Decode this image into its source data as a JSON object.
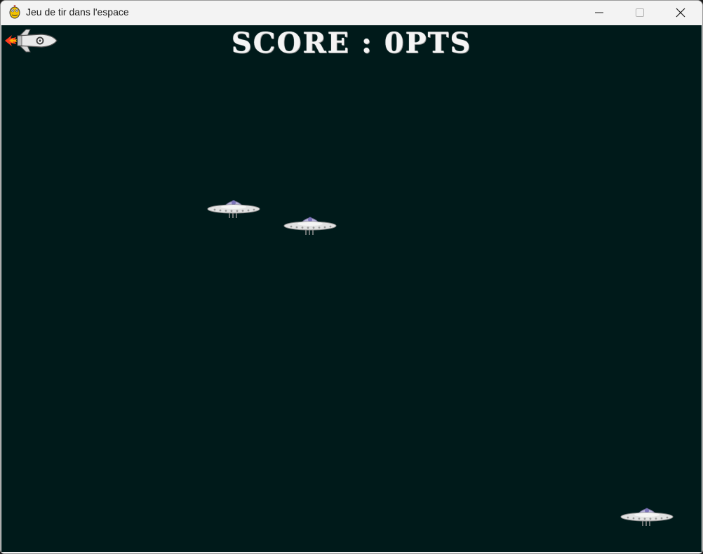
{
  "window": {
    "title": "Jeu de tir dans l'espace",
    "app_icon": "pygame-snake-icon",
    "controls": [
      "minimize-icon",
      "maximize-icon",
      "close-icon"
    ]
  },
  "game": {
    "background_color": "#001a1a",
    "score_label": "SCORE : 0PTS",
    "player": {
      "sprite": "rocket-icon"
    },
    "enemies": [
      {
        "sprite": "ufo-icon"
      },
      {
        "sprite": "ufo-icon"
      },
      {
        "sprite": "ufo-icon"
      }
    ]
  }
}
